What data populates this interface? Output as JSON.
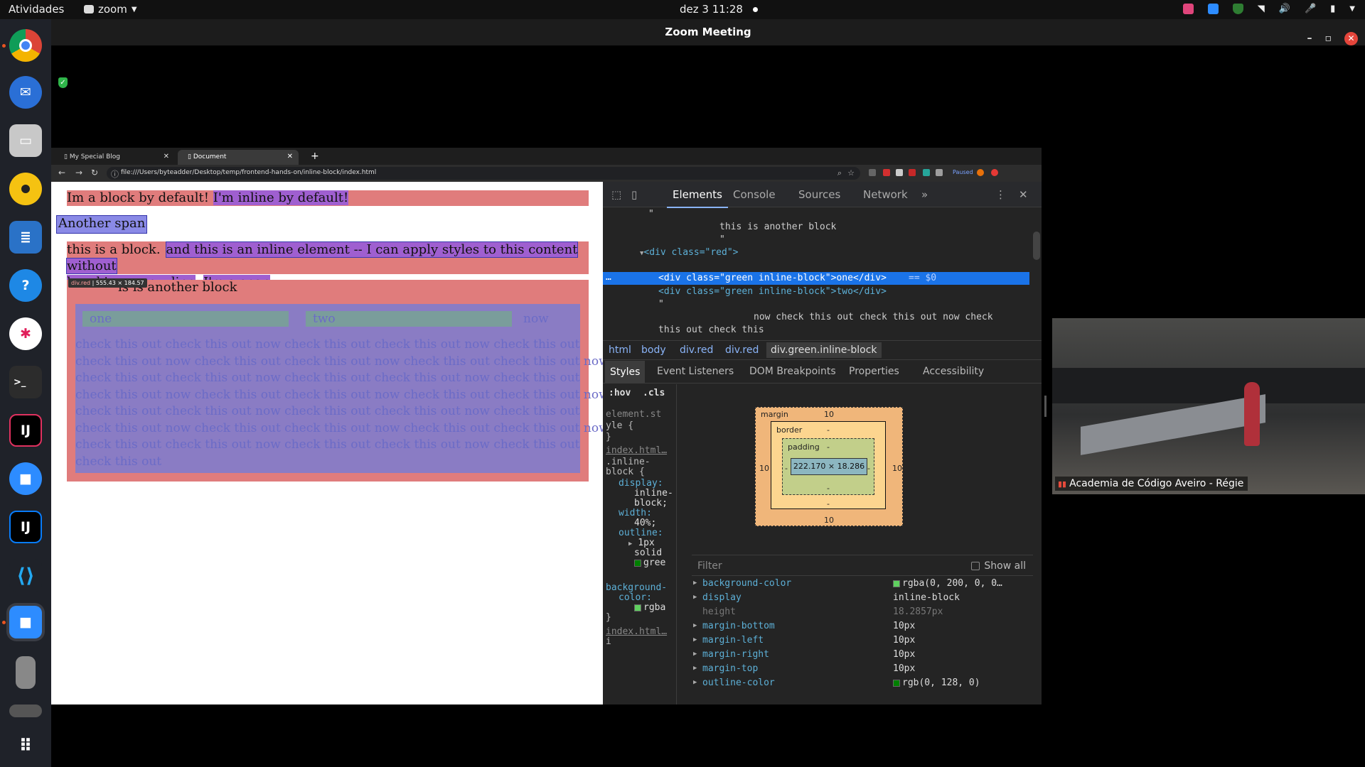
{
  "topbar": {
    "activities": "Atividades",
    "app_name": "zoom",
    "datetime": "dez 3  11:28"
  },
  "zoom": {
    "title": "Zoom Meeting",
    "participant_name": "Academia de Código Aveiro - Régie"
  },
  "browser": {
    "tabs": [
      "My Special Blog",
      "Document"
    ],
    "url": "file:///Users/byteadder/Desktop/temp/frontend-hands-on/inline-block/index.html",
    "paused_label": "Paused"
  },
  "page": {
    "block_default": "Im a block by default!",
    "inline_default": "I'm inline by default!",
    "another_span": "Another span",
    "this_block": "this is a block.",
    "inline_element_1": "and this is an inline element -- I can apply styles to this content without",
    "inline_element_2": "breaking a new line",
    "im_a_span": "I'm a span",
    "another_block": "is is another block",
    "tooltip_name": "div.red",
    "tooltip_size": "555.43 × 184.57",
    "green_one": "one",
    "green_two": "two",
    "now": "now",
    "check_lines": [
      "check this out check this out now check this out check this out now check this out",
      "check this out now check this out check this out now check this out check this out now",
      "check this out check this out now check this out check this out now check this out",
      "check this out now check this out check this out now check this out check this out now",
      "check this out check this out now check this out check this out now check this out",
      "check this out now check this out check this out now check this out check this out now",
      "check this out check this out now check this out check this out now check this out",
      "check this out"
    ]
  },
  "devtools": {
    "tabs": [
      "Elements",
      "Console",
      "Sources",
      "Network"
    ],
    "more": "»",
    "code": {
      "quote1": "\"",
      "another_block_text": "this is another block",
      "quote2": "\"",
      "div_red_open": "<div class=\"red\">",
      "div_one": "<div class=\"green inline-block\">one</div>",
      "eq_marker": "== $0",
      "div_two": "<div class=\"green inline-block\">two</div>",
      "quote3": "\"",
      "now_check_1": "now check this out check this out now check",
      "now_check_2": "this out check this"
    },
    "breadcrumbs": [
      "html",
      "body",
      "div.red",
      "div.red",
      "div.green.inline-block"
    ],
    "subtabs": [
      "Styles",
      "Event Listeners",
      "DOM Breakpoints",
      "Properties",
      "Accessibility"
    ],
    "hov": ":hov",
    "cls": ".cls",
    "rules": {
      "element_style_1": "element.st",
      "element_style_2": "yle {",
      "close1": "}",
      "source1": "index.html…",
      "selector1": ".inline-",
      "selector2": "block {",
      "display_prop": "display:",
      "display_val1": "inline-",
      "display_val2": "block;",
      "width_prop": "width:",
      "width_val": "40%;",
      "outline_prop": "outline:",
      "outline_val1": "1px",
      "outline_val2": "solid",
      "outline_val3": "gree",
      "bg_prop1": "background-",
      "bg_prop2": "color:",
      "bg_val": "rgba",
      "close2": "}",
      "source2": "index.html…",
      "trailing": "i"
    },
    "boxmodel": {
      "margin_label": "margin",
      "margin_top": "10",
      "margin_bottom": "10",
      "margin_left": "10",
      "margin_right": "10",
      "border_label": "border",
      "border_top": "-",
      "border_bottom": "-",
      "padding_label": "padding",
      "padding_top": "-",
      "padding_bottom": "-",
      "padding_left": "-",
      "padding_right": "-",
      "content": "222.170 × 18.286"
    },
    "filter_placeholder": "Filter",
    "show_all": "Show all",
    "computed": [
      {
        "name": "background-color",
        "value": "rgba(0, 200, 0, 0…",
        "swatch": "#5fd05f",
        "expandable": true
      },
      {
        "name": "display",
        "value": "inline-block",
        "expandable": true
      },
      {
        "name": "height",
        "value": "18.2857px",
        "expandable": false
      },
      {
        "name": "margin-bottom",
        "value": "10px",
        "expandable": true
      },
      {
        "name": "margin-left",
        "value": "10px",
        "expandable": true
      },
      {
        "name": "margin-right",
        "value": "10px",
        "expandable": true
      },
      {
        "name": "margin-top",
        "value": "10px",
        "expandable": true
      },
      {
        "name": "outline-color",
        "value": "rgb(0, 128, 0)",
        "swatch": "#008000",
        "expandable": true
      }
    ]
  },
  "colors": {
    "red_block": "#e07c7c",
    "purple_inline": "#9f5fd0",
    "blue_span": "#8a8ae6",
    "green_inline": "#7a9d9b",
    "selection": "#1a73e8",
    "orange_margin": "#f7c18c"
  }
}
